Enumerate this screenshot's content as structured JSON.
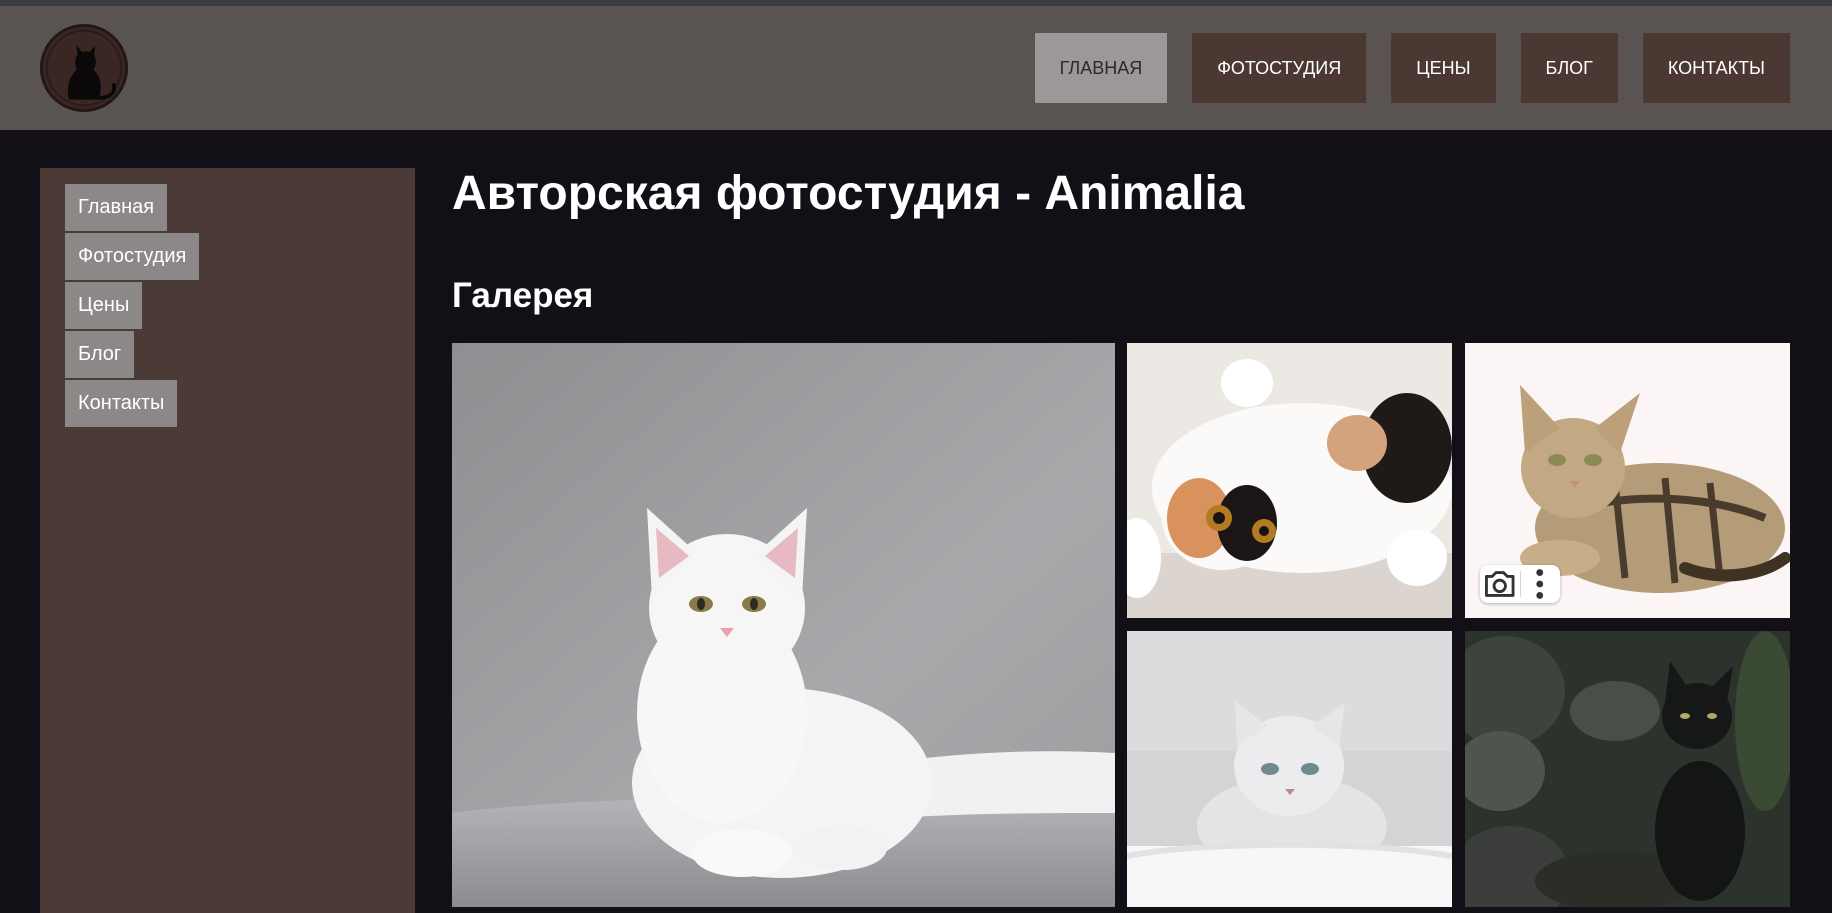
{
  "nav": {
    "items": [
      {
        "label": "Главная",
        "active": true
      },
      {
        "label": "Фотостудия",
        "active": false
      },
      {
        "label": "Цены",
        "active": false
      },
      {
        "label": "Блог",
        "active": false
      },
      {
        "label": "Контакты",
        "active": false
      }
    ]
  },
  "sidebar": {
    "items": [
      {
        "label": "Главная"
      },
      {
        "label": "Фотостудия"
      },
      {
        "label": "Цены"
      },
      {
        "label": "Блог"
      },
      {
        "label": "Контакты"
      }
    ]
  },
  "main": {
    "title": "Авторская фотостудия - Animalia",
    "gallery_title": "Галерея"
  },
  "gallery": {
    "photos": [
      {
        "subject": "white-maine-coon-cat"
      },
      {
        "subject": "calico-kitten-on-back"
      },
      {
        "subject": "tabby-kitten-lying"
      },
      {
        "subject": "silver-british-kitten"
      },
      {
        "subject": "black-cat-on-rocks"
      }
    ],
    "overlay_icons": [
      "visual-search-icon",
      "more-options-icon"
    ]
  },
  "colors": {
    "header_bg": "#595452",
    "nav_button_bg": "#4b3833",
    "nav_active_bg": "#9b9897",
    "sidebar_bg": "#4b3a35",
    "sidebar_item_bg": "#8c8887",
    "page_bg": "#121016"
  }
}
